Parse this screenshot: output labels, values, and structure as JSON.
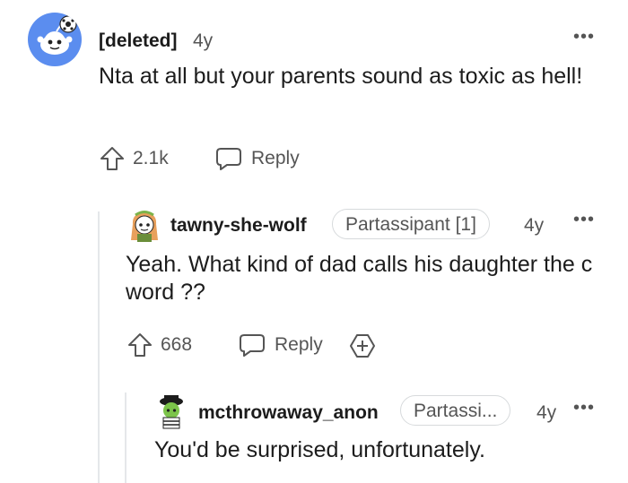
{
  "comments": [
    {
      "author": "[deleted]",
      "age": "4y",
      "text": "Nta at all but your parents sound as toxic as hell!",
      "votes": "2.1k",
      "reply_label": "Reply",
      "more_icon": "more-horizontal-icon"
    },
    {
      "author": "tawny-she-wolf",
      "flair": "Partassipant [1]",
      "age": "4y",
      "text": "Yeah. What kind of dad calls his daughter the c word ??",
      "votes": "668",
      "reply_label": "Reply",
      "award_icon": "add-award-icon"
    },
    {
      "author": "mcthrowaway_anon",
      "flair": "Partassi...",
      "age": "4y",
      "text": "You'd be surprised, unfortunately."
    }
  ],
  "colors": {
    "avatar_blue": "#5b8def",
    "text": "#1c1c1c",
    "meta": "#555555",
    "thread_line": "#e5e7ea"
  }
}
